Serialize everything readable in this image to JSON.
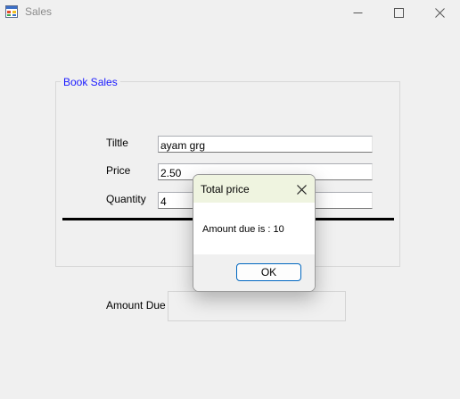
{
  "window": {
    "title": "Sales",
    "icon": "app-form-icon"
  },
  "group": {
    "legend": "Book Sales",
    "accent": "#1a1aff"
  },
  "form": {
    "title_label": "Tiltle",
    "title_value": "ayam grg",
    "price_label": "Price",
    "price_value": "2.50",
    "quantity_label": "Quantity",
    "quantity_value": "4"
  },
  "amount": {
    "label": "Amount Due",
    "value": ""
  },
  "dialog": {
    "title": "Total price",
    "message": "Amount due is : 10",
    "ok_label": "OK",
    "close_icon": "close-icon"
  }
}
